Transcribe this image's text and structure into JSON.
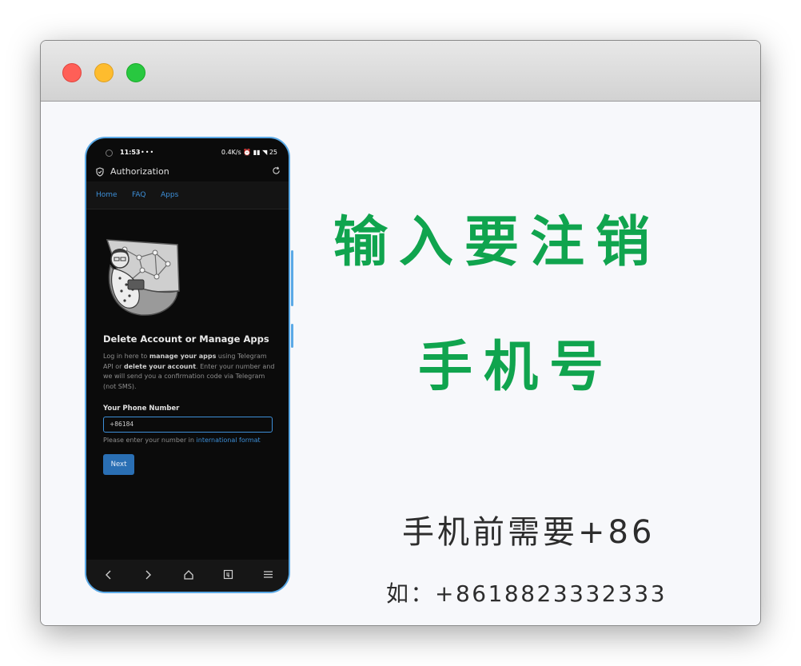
{
  "window": {
    "traffic_lights": [
      "close",
      "minimize",
      "zoom"
    ]
  },
  "phone": {
    "status_bar": {
      "time": "11:53",
      "dots": "•••",
      "right": "0.4K/s ⏰ ▮▮ ◥ 25"
    },
    "app_title": "Authorization",
    "nav": {
      "home": "Home",
      "faq": "FAQ",
      "apps": "Apps"
    },
    "heading": "Delete Account or Manage Apps",
    "description": {
      "p1": "Log in here to ",
      "b1": "manage your apps",
      "p2": " using Telegram API or ",
      "b2": "delete your account",
      "p3": ". Enter your number and we will send you a confirmation code via Telegram (not SMS)."
    },
    "phone_label": "Your Phone Number",
    "phone_value": "+86184",
    "hint_text": "Please enter your number in ",
    "hint_link": "international format",
    "next_button": "Next"
  },
  "headline": {
    "line1": "输入要注销",
    "line2": "手机号"
  },
  "note": "手机前需要+86",
  "example": "如：+8618823332333",
  "colors": {
    "green": "#10a44e",
    "link": "#3d8fd8",
    "button": "#2a6fb4"
  }
}
